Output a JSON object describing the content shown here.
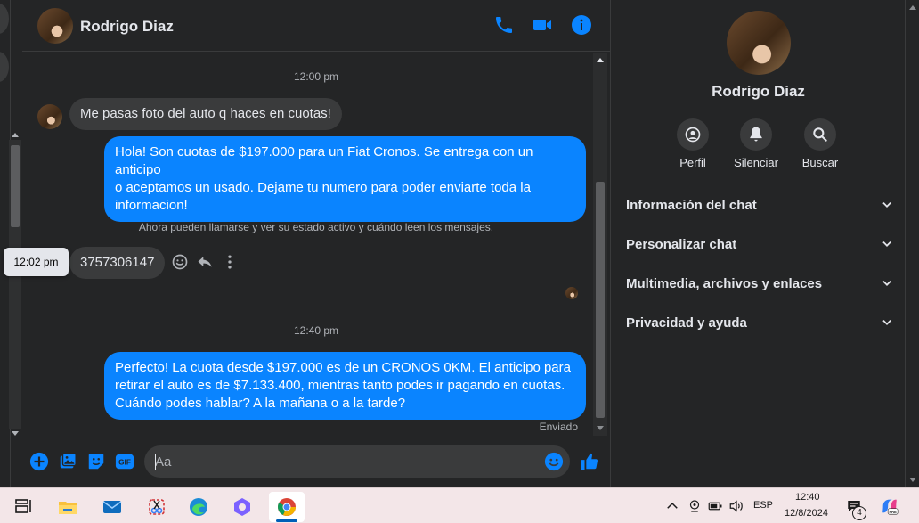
{
  "chat": {
    "contact_name": "Rodrigo Diaz",
    "messages": [
      {
        "type": "time",
        "text": "12:00 pm"
      },
      {
        "type": "in",
        "text": "Me pasas foto del auto q haces en cuotas!"
      },
      {
        "type": "out",
        "lines": [
          "Hola! Son cuotas de $197.000 para un Fiat Cronos. Se entrega con un anticipo",
          "o aceptamos un usado. Dejame tu numero para poder enviarte toda la",
          "informacion!"
        ]
      },
      {
        "type": "notice",
        "text": "Ahora pueden llamarse y ver su estado activo y cuándo leen los mensajes."
      },
      {
        "type": "in",
        "text": "3757306147",
        "tooltip": "12:02 pm"
      },
      {
        "type": "time",
        "text": "12:40 pm"
      },
      {
        "type": "out",
        "lines": [
          "Perfecto! La cuota desde $197.000 es de un CRONOS 0KM. El anticipo para",
          "retirar el auto es de $7.133.400, mientras tanto podes ir pagando en cuotas.",
          "Cuándo podes hablar? A la mañana o a la tarde?"
        ]
      }
    ],
    "sent_status": "Enviado",
    "composer_placeholder": "Aa"
  },
  "info_panel": {
    "name": "Rodrigo Diaz",
    "actions": [
      {
        "label": "Perfil",
        "icon": "profile-icon"
      },
      {
        "label": "Silenciar",
        "icon": "bell-icon"
      },
      {
        "label": "Buscar",
        "icon": "search-icon"
      }
    ],
    "sections": [
      "Información del chat",
      "Personalizar chat",
      "Multimedia, archivos y enlaces",
      "Privacidad y ayuda"
    ]
  },
  "taskbar": {
    "language": "ESP",
    "time": "12:40",
    "date": "12/8/2024",
    "notification_count": "4"
  },
  "colors": {
    "accent": "#0a84ff",
    "background": "#242526",
    "bubble_in": "#3a3b3c"
  }
}
